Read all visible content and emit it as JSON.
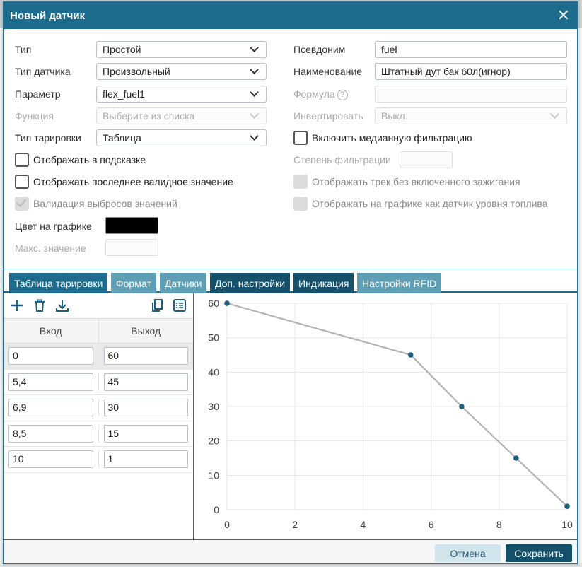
{
  "dialog": {
    "title": "Новый датчик"
  },
  "form": {
    "type": {
      "label": "Тип",
      "value": "Простой"
    },
    "sensor_type": {
      "label": "Тип датчика",
      "value": "Произвольный"
    },
    "parameter": {
      "label": "Параметр",
      "value": "flex_fuel1"
    },
    "function": {
      "label": "Функция",
      "placeholder": "Выберите из списка"
    },
    "calibration_type": {
      "label": "Тип тарировки",
      "value": "Таблица"
    },
    "alias": {
      "label": "Псевдоним",
      "value": "fuel"
    },
    "name": {
      "label": "Наименование",
      "value": "Штатный дут бак 60л(игнор)"
    },
    "formula": {
      "label": "Формула",
      "value": ""
    },
    "invert": {
      "label": "Инвертировать",
      "value": "Выкл."
    },
    "median_filter_label": "Включить медианную фильтрацию",
    "filter_degree_label": "Степень фильтрации",
    "show_in_tooltip_label": "Отображать в подсказке",
    "show_last_valid_label": "Отображать последнее валидное значение",
    "outlier_validation_label": "Валидация выбросов значений",
    "show_track_no_ignition_label": "Отображать трек без включенного зажигания",
    "show_as_fuel_level_label": "Отображать на графике как датчик уровня топлива",
    "graph_color_label": "Цвет на графике",
    "graph_color": "#000000",
    "max_value_label": "Макс. значение"
  },
  "tabs": [
    "Таблица тарировки",
    "Формат",
    "Датчики",
    "Доп. настройки",
    "Индикация",
    "Настройки RFID"
  ],
  "table": {
    "headers": [
      "Вход",
      "Выход"
    ],
    "rows": [
      [
        "0",
        "60"
      ],
      [
        "5,4",
        "45"
      ],
      [
        "6,9",
        "30"
      ],
      [
        "8,5",
        "15"
      ],
      [
        "10",
        "1"
      ]
    ]
  },
  "chart_data": {
    "type": "line",
    "x": [
      0,
      5.4,
      6.9,
      8.5,
      10
    ],
    "y": [
      60,
      45,
      30,
      15,
      1
    ],
    "xlim": [
      0,
      10
    ],
    "ylim": [
      0,
      60
    ],
    "xticks": [
      0,
      2,
      4,
      6,
      8,
      10
    ],
    "yticks": [
      0,
      10,
      20,
      30,
      40,
      50,
      60
    ],
    "grid": true,
    "line_color": "#b3b3b3",
    "point_color": "#1d5f7e"
  },
  "footer": {
    "cancel": "Отмена",
    "save": "Сохранить"
  },
  "colors": {
    "accent": "#1d6b8d",
    "accent_dark": "#15516b",
    "tab_light": "#5f9fb5"
  }
}
